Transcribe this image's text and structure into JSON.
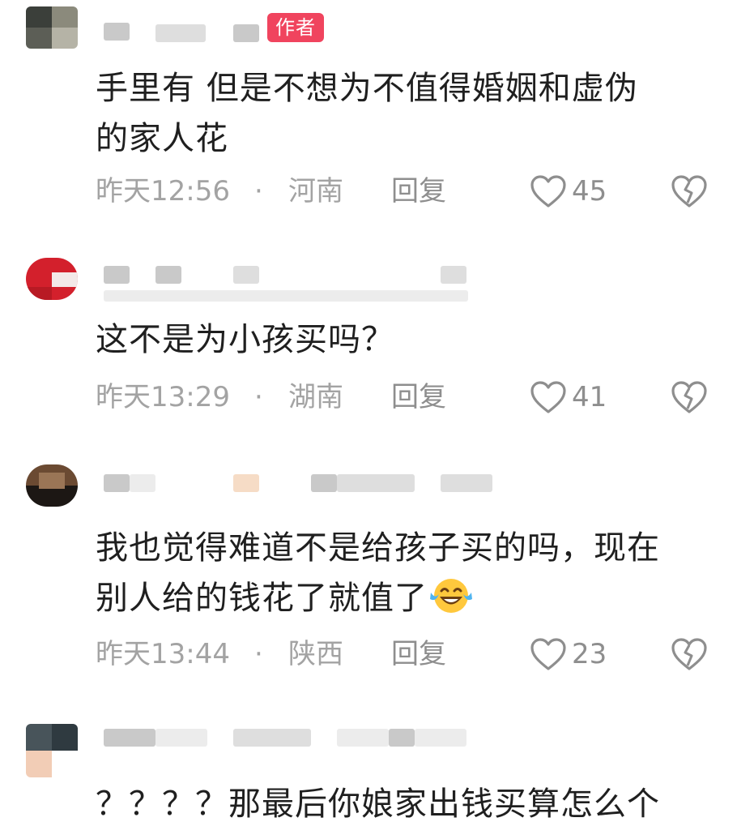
{
  "comments": [
    {
      "author_badge": "作者",
      "text_lines": [
        "手里有 但是不想为不值得婚姻和虚伪",
        "的家人花"
      ],
      "time": "昨天12:56",
      "separator": "·",
      "region": "河南",
      "reply_label": "回复",
      "likes": "45"
    },
    {
      "text_lines": [
        "这不是为小孩买吗？"
      ],
      "time": "昨天13:29",
      "separator": "·",
      "region": "湖南",
      "reply_label": "回复",
      "likes": "41"
    },
    {
      "text_lines": [
        "我也觉得难道不是给孩子买的吗，现在",
        "别人给的钱花了就值了"
      ],
      "emoji": "laughing-tears-emoji",
      "time": "昨天13:44",
      "separator": "·",
      "region": "陕西",
      "reply_label": "回复",
      "likes": "23"
    },
    {
      "text_lines": [
        "？？？？那最后你娘家出钱买算怎么个"
      ]
    }
  ],
  "icons": {
    "like": "heart-outline-icon",
    "dislike": "broken-heart-icon"
  },
  "colors": {
    "badge": "#f0445e",
    "meta_text": "#a3a3a3",
    "body_text": "#1f1f1f"
  }
}
